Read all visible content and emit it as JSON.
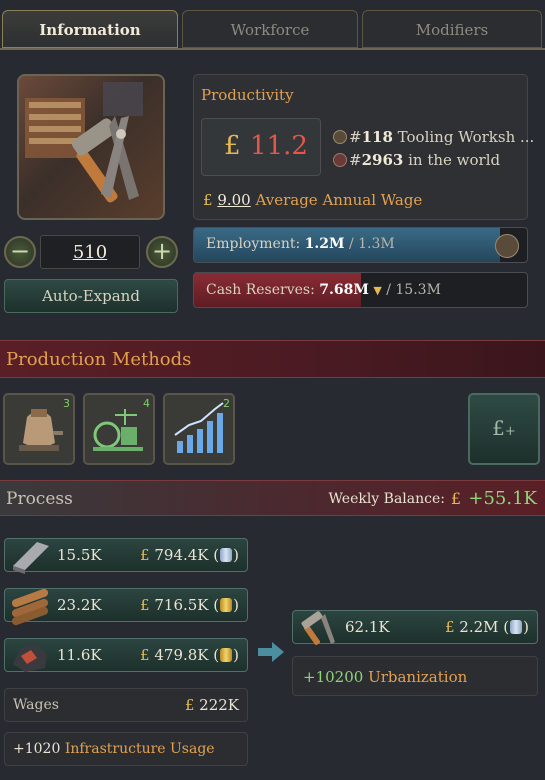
{
  "tabs": [
    {
      "label": "Information"
    },
    {
      "label": "Workforce"
    },
    {
      "label": "Modifiers"
    }
  ],
  "building": {
    "level": "510",
    "auto_expand_label": "Auto-Expand"
  },
  "productivity": {
    "title": "Productivity",
    "currency": "£",
    "value": "11.2",
    "rank_local_prefix": "#",
    "rank_local": "118",
    "rank_local_label": "Tooling Worksh ...",
    "rank_world_prefix": "#",
    "rank_world": "2963",
    "rank_world_label": "in the world",
    "wage_value": "9.00",
    "wage_label": "Average Annual Wage"
  },
  "employment": {
    "label": "Employment:",
    "value": "1.2M",
    "max": "/ 1.3M",
    "fill_fraction": 0.92
  },
  "cash": {
    "label": "Cash Reserves:",
    "value": "7.68M",
    "max": "/ 15.3M",
    "fill_fraction": 0.5
  },
  "production_methods": {
    "title": "Production Methods",
    "slots": [
      {
        "icon": "bell-furnace-icon",
        "badge": "3"
      },
      {
        "icon": "steam-machinery-icon",
        "badge": "4"
      },
      {
        "icon": "growth-chart-icon",
        "badge": "2"
      }
    ]
  },
  "process": {
    "title": "Process",
    "balance_label": "Weekly Balance:",
    "balance_value": "+55.1K",
    "inputs": [
      {
        "icon": "steel-icon",
        "amount": "15.5K",
        "value": "794.4K",
        "coin": "silver"
      },
      {
        "icon": "wood-icon",
        "amount": "23.2K",
        "value": "716.5K",
        "coin": "gold"
      },
      {
        "icon": "coal-icon",
        "amount": "11.6K",
        "value": "479.8K",
        "coin": "gold"
      }
    ],
    "wages_label": "Wages",
    "wages_value": "222K",
    "infrastructure_value": "+1020",
    "infrastructure_label": "Infrastructure Usage",
    "output": {
      "icon": "tools-icon",
      "amount": "62.1K",
      "value": "2.2M",
      "coin": "silver"
    },
    "urbanization_value": "+10200",
    "urbanization_label": "Urbanization"
  },
  "colors": {
    "accent_gold": "#e4b84f",
    "positive": "#8fd57a",
    "banner": "#5a1f26"
  }
}
